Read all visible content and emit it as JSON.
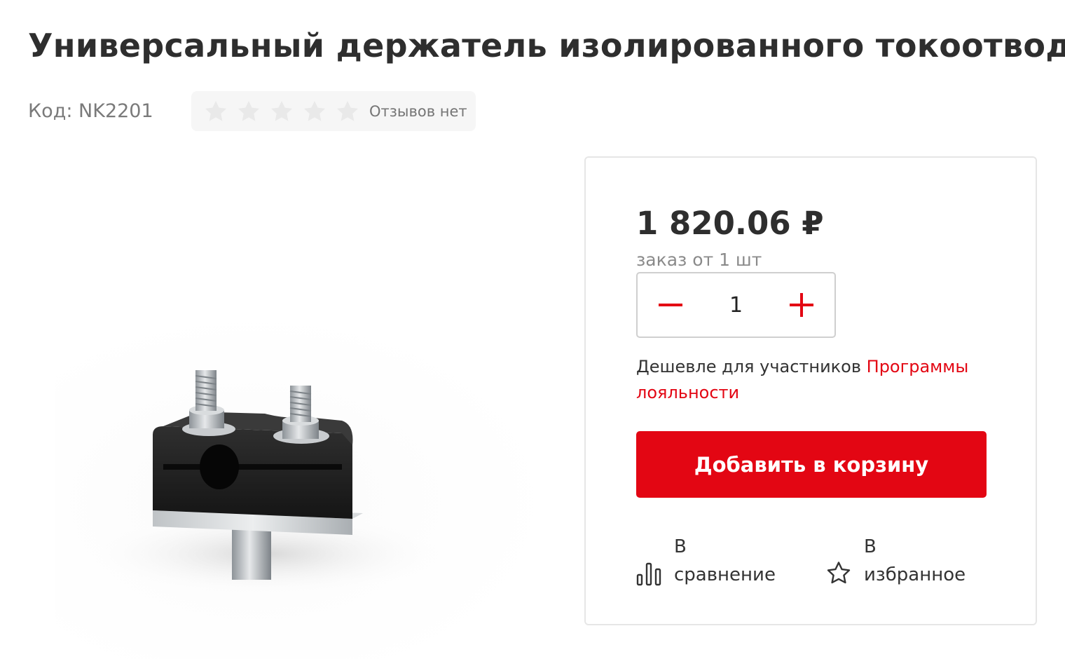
{
  "product": {
    "title": "Универсальный держатель изолированного токоотвода",
    "code": "Код: NK2201",
    "rating": {
      "stars_filled": 0,
      "stars_total": 5,
      "reviews_text": "Отзывов нет"
    },
    "image_alt": "Универсальный держатель изолированного токоотвода"
  },
  "buy_card": {
    "price": "1 820.06 ₽",
    "min_order": "заказ от 1 шт",
    "quantity": "1",
    "loyalty_text": "Дешевле для участников ",
    "loyalty_link": "Программы лояльности",
    "add_to_cart": "Добавить в корзину",
    "compare": {
      "line1": "В",
      "line2": "сравнение",
      "icon": "bar-chart-icon"
    },
    "favorite": {
      "line1": "В",
      "line2": "избранное",
      "icon": "star-outline-icon"
    }
  },
  "colors": {
    "accent": "#e30613",
    "text": "#2e2e2e",
    "muted": "#7a7a7a",
    "star_empty": "#e9e9e9"
  }
}
